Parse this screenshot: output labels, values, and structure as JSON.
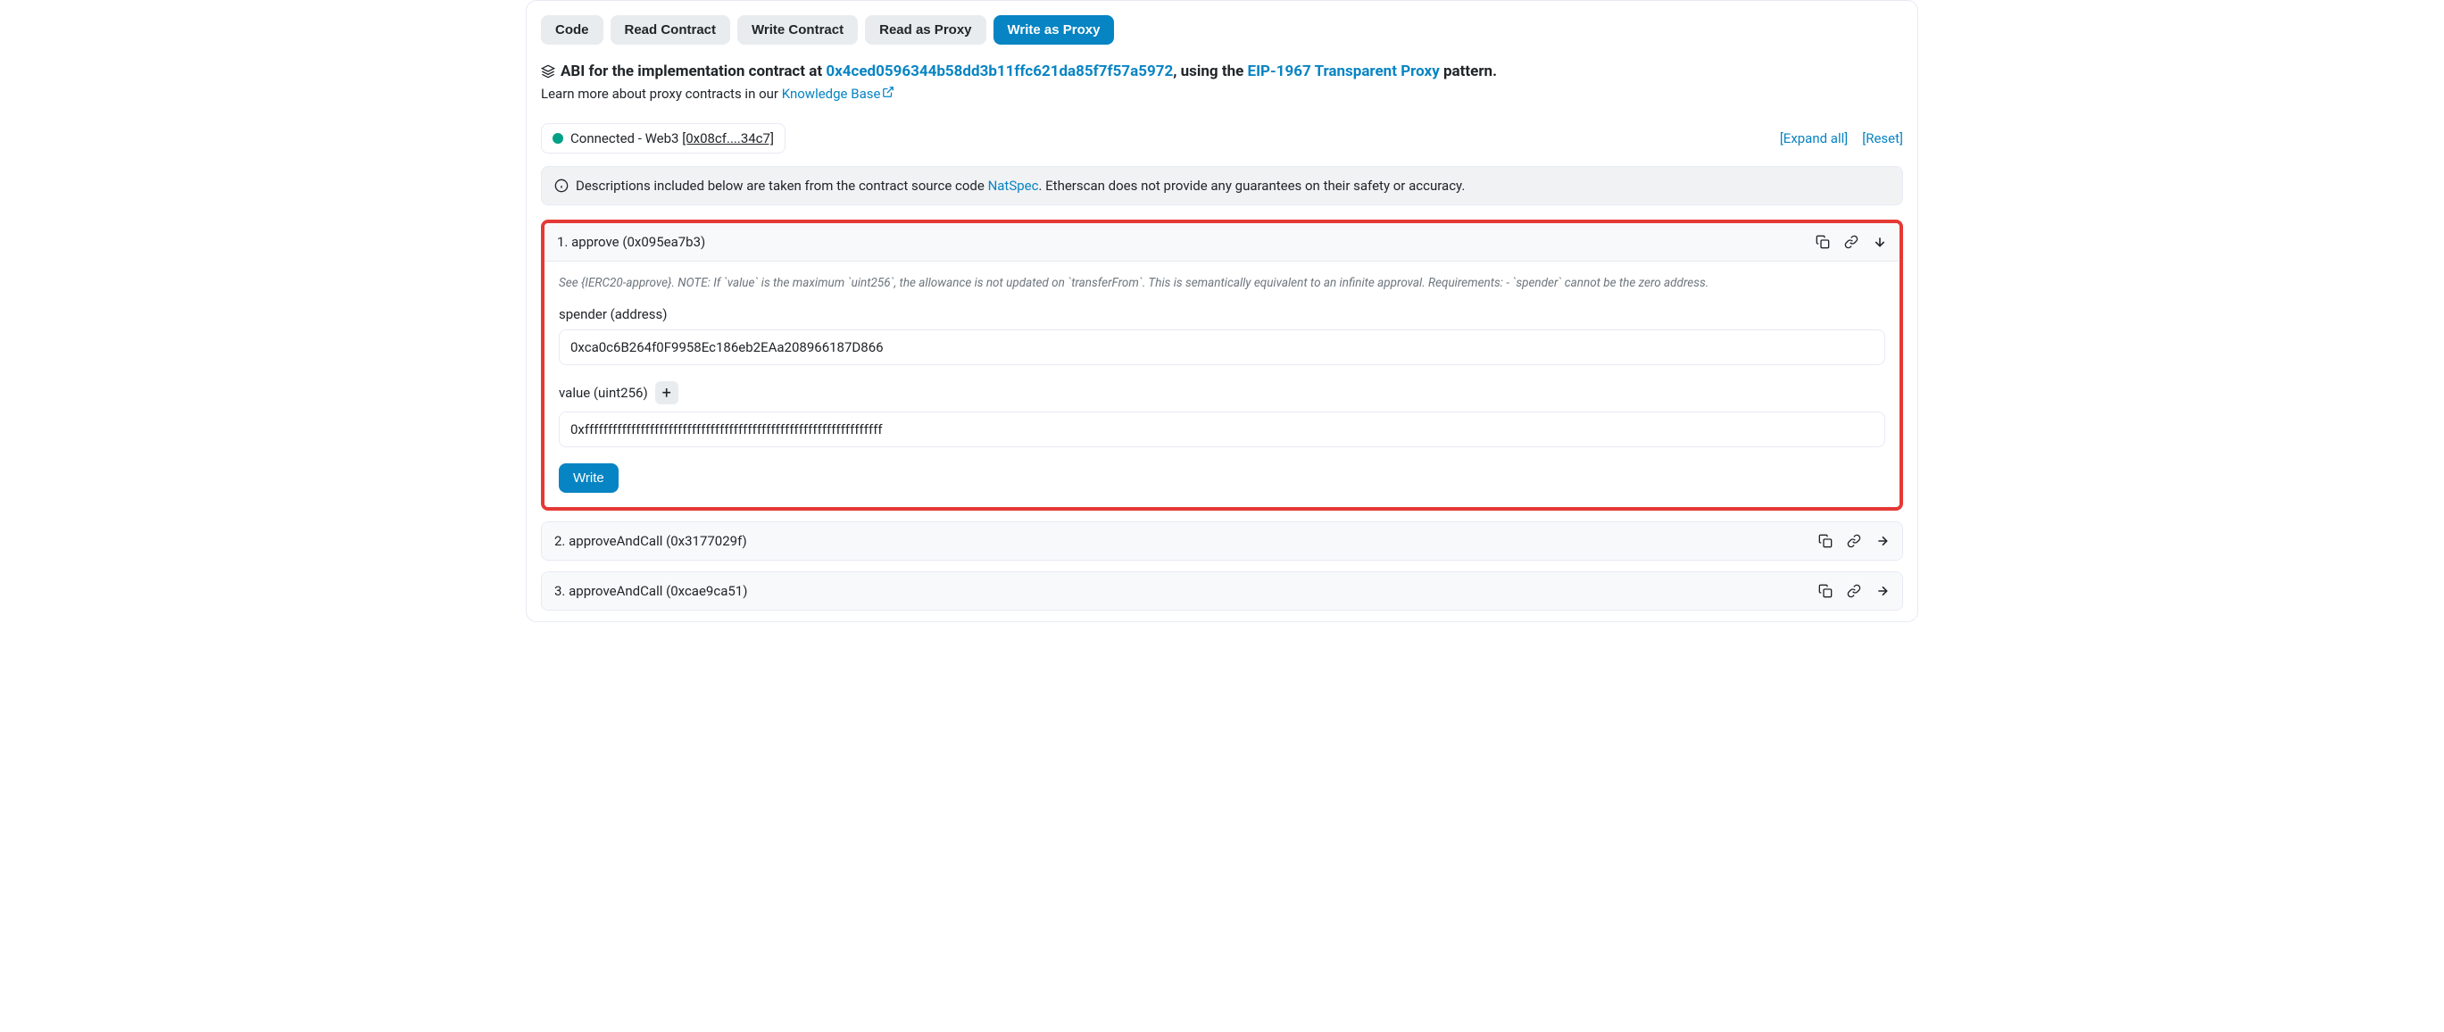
{
  "tabs": {
    "code": "Code",
    "read_contract": "Read Contract",
    "write_contract": "Write Contract",
    "read_proxy": "Read as Proxy",
    "write_proxy": "Write as Proxy"
  },
  "abi_line": {
    "prefix": "ABI for the implementation contract at ",
    "impl_addr": "0x4ced0596344b58dd3b11ffc621da85f7f57a5972",
    "middle": ", using the ",
    "proxy_pattern": "EIP-1967 Transparent Proxy",
    "suffix": " pattern."
  },
  "learn_more": {
    "prefix": "Learn more about proxy contracts in our ",
    "link": "Knowledge Base"
  },
  "connection": {
    "label": "Connected - Web3 ",
    "short_addr": "[0x08cf....34c7]"
  },
  "right_actions": {
    "expand": "[Expand all]",
    "reset": "[Reset]"
  },
  "notice": {
    "prefix": "Descriptions included below are taken from the contract source code ",
    "natspec": "NatSpec",
    "suffix": ". Etherscan does not provide any guarantees on their safety or accuracy."
  },
  "functions": [
    {
      "title": "1. approve (0x095ea7b3)",
      "description": "See {IERC20-approve}. NOTE: If `value` is the maximum `uint256`, the allowance is not updated on `transferFrom`. This is semantically equivalent to an infinite approval. Requirements: - `spender` cannot be the zero address.",
      "fields": {
        "spender": {
          "label": "spender (address)",
          "value": "0xca0c6B264f0F9958Ec186eb2EAa208966187D866"
        },
        "value": {
          "label": "value (uint256)",
          "value": "0xffffffffffffffffffffffffffffffffffffffffffffffffffffffffffffffff"
        }
      },
      "write_label": "Write"
    },
    {
      "title": "2. approveAndCall (0x3177029f)"
    },
    {
      "title": "3. approveAndCall (0xcae9ca51)"
    }
  ]
}
